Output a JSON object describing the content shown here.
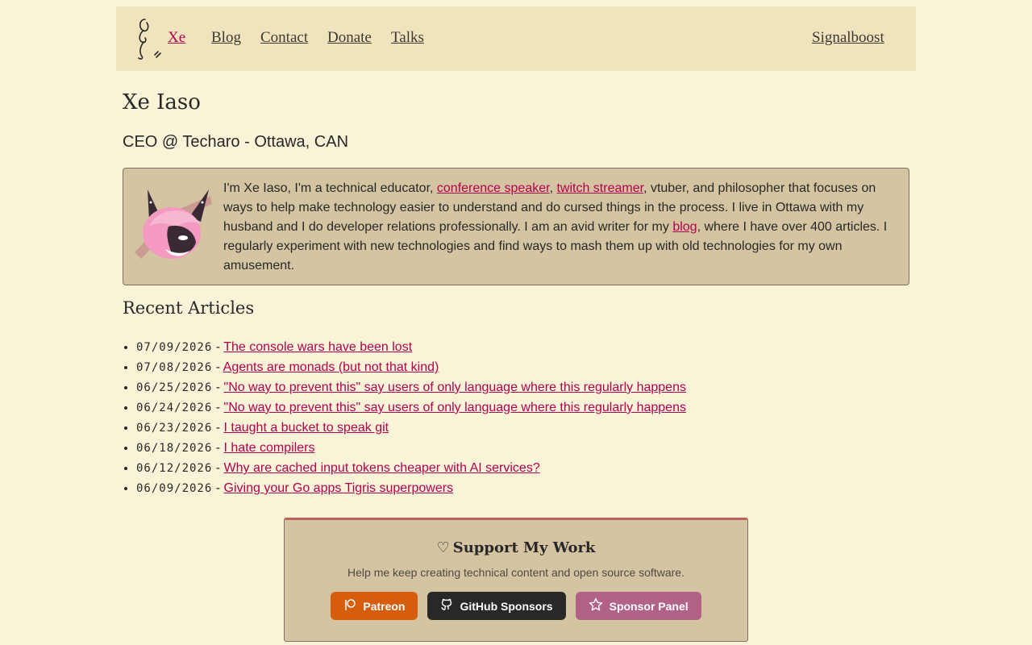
{
  "nav": {
    "brand": "Xe",
    "items": [
      "Blog",
      "Contact",
      "Donate",
      "Talks"
    ],
    "right": "Signalboost"
  },
  "profile": {
    "name": "Xe Iaso",
    "subtitle": "CEO @ Techaro - Ottawa, CAN"
  },
  "about": {
    "text_1": "I'm Xe Iaso, I'm a technical educator, ",
    "link_speaker": "conference speaker",
    "text_2": ", ",
    "link_twitch": "twitch streamer",
    "text_3": ", vtuber, and philosopher that focuses on ways to help make technology easier to understand and do cursed things in the process. I live in Ottawa with my husband and I do developer relations professionally. I am an avid writer for my ",
    "link_blog": "blog",
    "text_4": ", where I have over 400 articles. I regularly experiment with new technologies and find ways to mash them up with old technologies for my own amusement."
  },
  "recent": {
    "heading": "Recent Articles",
    "separator": " - ",
    "articles": [
      {
        "date": "07/09/2026",
        "title": "The console wars have been lost"
      },
      {
        "date": "07/08/2026",
        "title": "Agents are monads (but not that kind)"
      },
      {
        "date": "06/25/2026",
        "title": "\"No way to prevent this\" say users of only language where this regularly happens"
      },
      {
        "date": "06/24/2026",
        "title": "\"No way to prevent this\" say users of only language where this regularly happens"
      },
      {
        "date": "06/23/2026",
        "title": "I taught a bucket to speak git"
      },
      {
        "date": "06/18/2026",
        "title": "I hate compilers"
      },
      {
        "date": "06/12/2026",
        "title": "Why are cached input tokens cheaper with AI services?"
      },
      {
        "date": "06/09/2026",
        "title": "Giving your Go apps Tigris superpowers"
      }
    ]
  },
  "support": {
    "icon": "heart-icon",
    "title": "Support My Work",
    "description": "Help me keep creating technical content and open source software.",
    "buttons": {
      "patreon": "Patreon",
      "github": "GitHub Sponsors",
      "sponsor_panel": "Sponsor Panel"
    }
  },
  "colors": {
    "background": "#f9f4d8",
    "nav_bg": "#f1e4bc",
    "card_bg": "#d5c4a1",
    "link": "#b3004f",
    "patreon": "#d65d0e",
    "github": "#282828",
    "sponsor": "#b16286"
  }
}
